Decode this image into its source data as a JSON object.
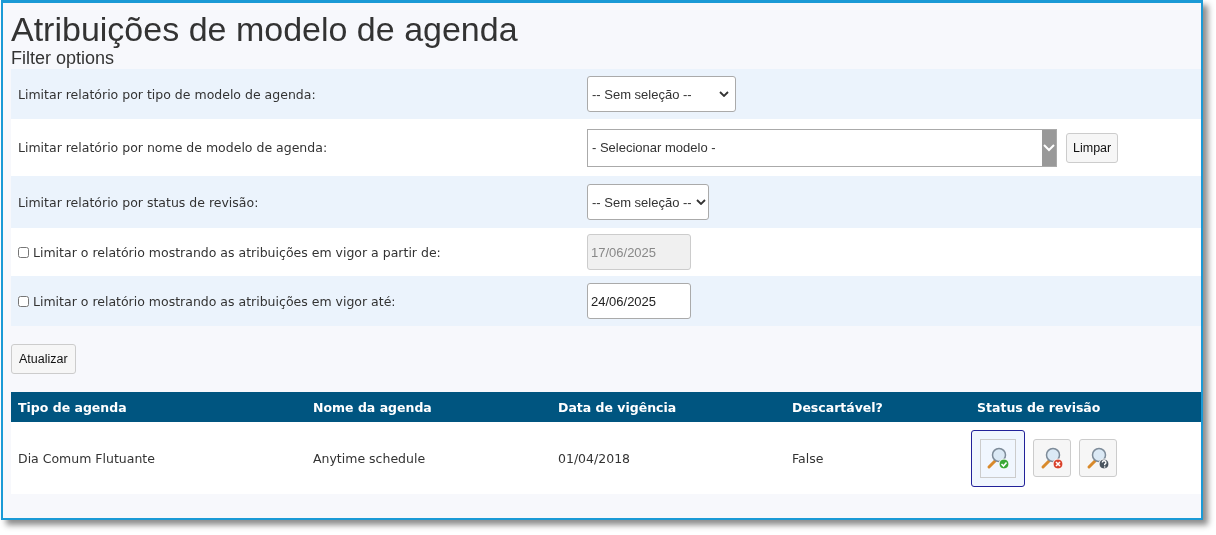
{
  "title": "Atribuições de modelo de agenda",
  "subtitle": "Filter options",
  "filters": [
    {
      "kind": "select",
      "label": "Limitar relatório por tipo de modelo de agenda:",
      "value": "-- Sem seleção --"
    },
    {
      "kind": "wide-select",
      "label": "Limitar relatório por nome de modelo de agenda:",
      "value": "- Selecionar modelo -",
      "button": "Limpar"
    },
    {
      "kind": "select",
      "label": "Limitar relatório por status de revisão:",
      "value": "-- Sem seleção --"
    },
    {
      "kind": "date",
      "label": "Limitar o relatório mostrando as atribuições em vigor a partir de:",
      "checked": false,
      "value": "17/06/2025",
      "disabled": true
    },
    {
      "kind": "date",
      "label": "Limitar o relatório mostrando as atribuições em vigor até:",
      "checked": false,
      "value": "24/06/2025",
      "disabled": false
    }
  ],
  "update_button": "Atualizar",
  "table": {
    "columns": [
      "Tipo de agenda",
      "Nome da agenda",
      "Data de vigência",
      "Descartável?",
      "Status de revisão"
    ],
    "rows": [
      {
        "cells": [
          "Dia Comum Flutuante",
          "Anytime schedule",
          "01/04/2018",
          "False"
        ],
        "status_buttons": [
          {
            "kind": "approved",
            "selected": true
          },
          {
            "kind": "rejected",
            "selected": false
          },
          {
            "kind": "unknown",
            "selected": false
          }
        ]
      }
    ]
  }
}
